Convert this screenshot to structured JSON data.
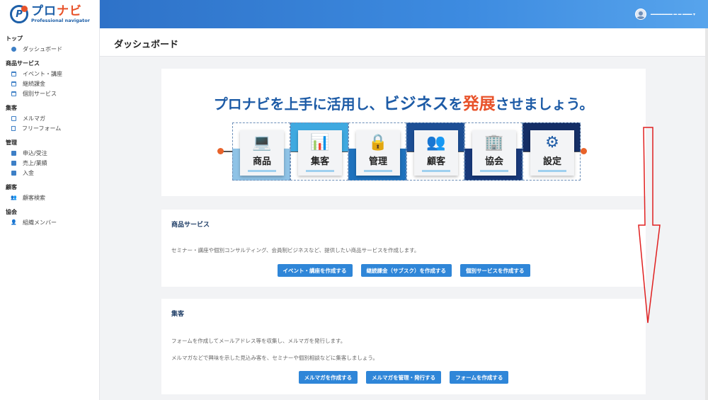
{
  "brand": {
    "name_a": "プロ",
    "name_b": "ナビ",
    "tagline": "Professional navigator",
    "mark_letter": "P"
  },
  "colors": {
    "primary": "#2f86d8",
    "brand_blue": "#1d5ba6",
    "accent_orange": "#e8532b",
    "annotation_red": "#e02020"
  },
  "sidebar": {
    "groups": [
      {
        "heading": "トップ",
        "items": [
          {
            "label": "ダッシュボード",
            "icon": "dashboard-icon"
          }
        ]
      },
      {
        "heading": "商品サービス",
        "items": [
          {
            "label": "イベント・講座",
            "icon": "calendar-icon"
          },
          {
            "label": "継続課金",
            "icon": "calendar-icon"
          },
          {
            "label": "個別サービス",
            "icon": "calendar-icon"
          }
        ]
      },
      {
        "heading": "集客",
        "items": [
          {
            "label": "メルマガ",
            "icon": "mail-icon"
          },
          {
            "label": "フリーフォーム",
            "icon": "form-icon"
          }
        ]
      },
      {
        "heading": "管理",
        "items": [
          {
            "label": "申込/受注",
            "icon": "calendar-icon"
          },
          {
            "label": "売上/業績",
            "icon": "calendar-icon"
          },
          {
            "label": "入金",
            "icon": "calendar-icon"
          }
        ]
      },
      {
        "heading": "顧客",
        "items": [
          {
            "label": "顧客検索",
            "icon": "users-icon"
          }
        ]
      },
      {
        "heading": "協会",
        "items": [
          {
            "label": "組織メンバー",
            "icon": "user-icon"
          }
        ]
      }
    ]
  },
  "header": {
    "user_name": "━━━━━━━ ━ ━ ━━━",
    "caret": "▾"
  },
  "page": {
    "title": "ダッシュボード"
  },
  "hero": {
    "text_1": "プロナビを上手に活用し、",
    "text_2": "ビジネス",
    "text_3": "を",
    "text_4": "発展",
    "text_5": "させましょう。",
    "tiles": [
      {
        "label": "商品",
        "icon": "laptop-icon",
        "glyph": "💻"
      },
      {
        "label": "集客",
        "icon": "bar-chart-icon",
        "glyph": "📊"
      },
      {
        "label": "管理",
        "icon": "lock-icon",
        "glyph": "🔒"
      },
      {
        "label": "顧客",
        "icon": "people-icon",
        "glyph": "👥"
      },
      {
        "label": "協会",
        "icon": "building-icon",
        "glyph": "🏢"
      },
      {
        "label": "設定",
        "icon": "gear-icon",
        "glyph": "⚙"
      }
    ]
  },
  "sections": {
    "products": {
      "title": "商品サービス",
      "desc": "セミナー・講座や個別コンサルティング、会員制ビジネスなど、提供したい商品サービスを作成します。",
      "buttons": [
        "イベント・講座を作成する",
        "継続課金（サブスク）を作成する",
        "個別サービスを作成する"
      ]
    },
    "marketing": {
      "title": "集客",
      "desc_1": "フォームを作成してメールアドレス等を収集し、メルマガを発行します。",
      "desc_2": "メルマガなどで興味を示した見込み客を、セミナーや個別相談などに集客しましょう。",
      "buttons": [
        "メルマガを作成する",
        "メルマガを管理・発行する",
        "フォームを作成する"
      ]
    }
  }
}
